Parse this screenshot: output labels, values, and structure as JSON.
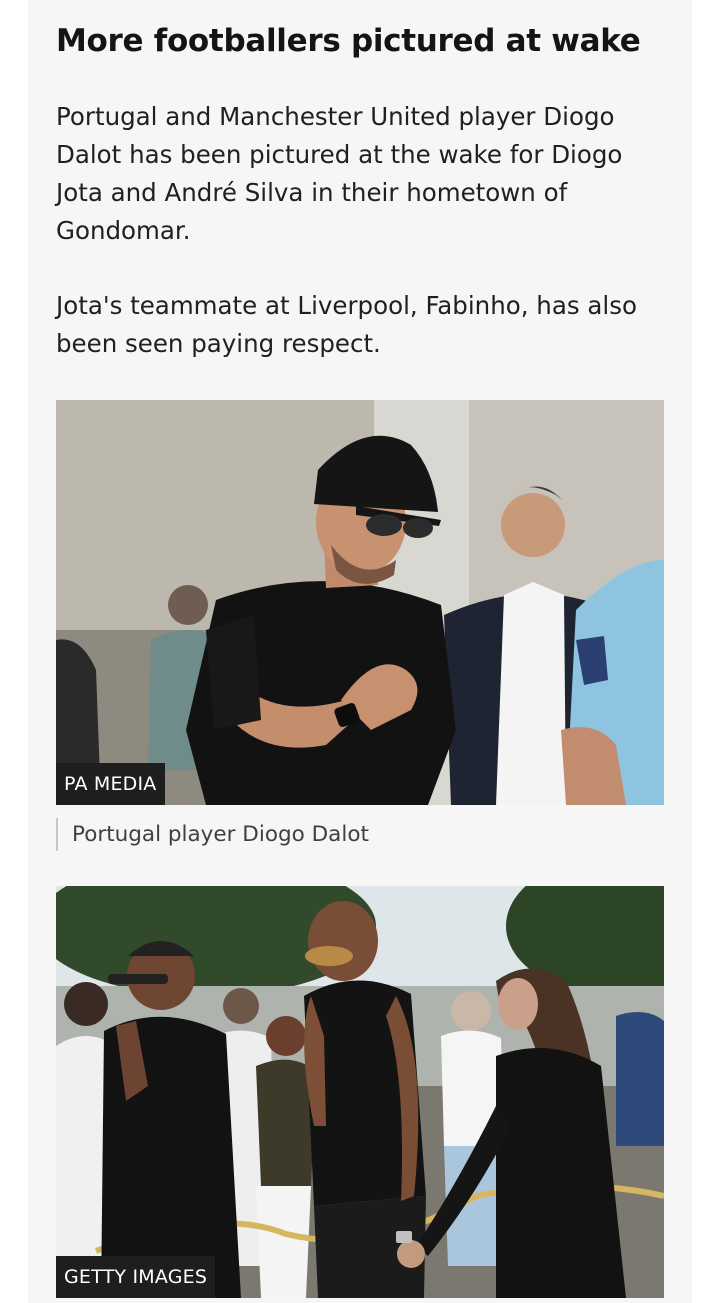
{
  "article": {
    "headline": "More footballers pictured at wake",
    "paragraphs": [
      "Portugal and Manchester United player Diogo Dalot has been pictured at the wake for Diogo Jota and André Silva in their hometown of Gondomar.",
      "Jota's teammate at Liverpool, Fabinho, has also been seen paying respect."
    ]
  },
  "images": [
    {
      "credit": "PA MEDIA",
      "caption": "Portugal player Diogo Dalot"
    },
    {
      "credit": "GETTY IMAGES"
    }
  ],
  "colors": {
    "card_background": "#f6f6f6",
    "headline_text": "#141414",
    "body_text": "#202020",
    "caption_text": "#3f3f3f",
    "credit_background": "#1e1e1e",
    "credit_text": "#ffffff"
  }
}
